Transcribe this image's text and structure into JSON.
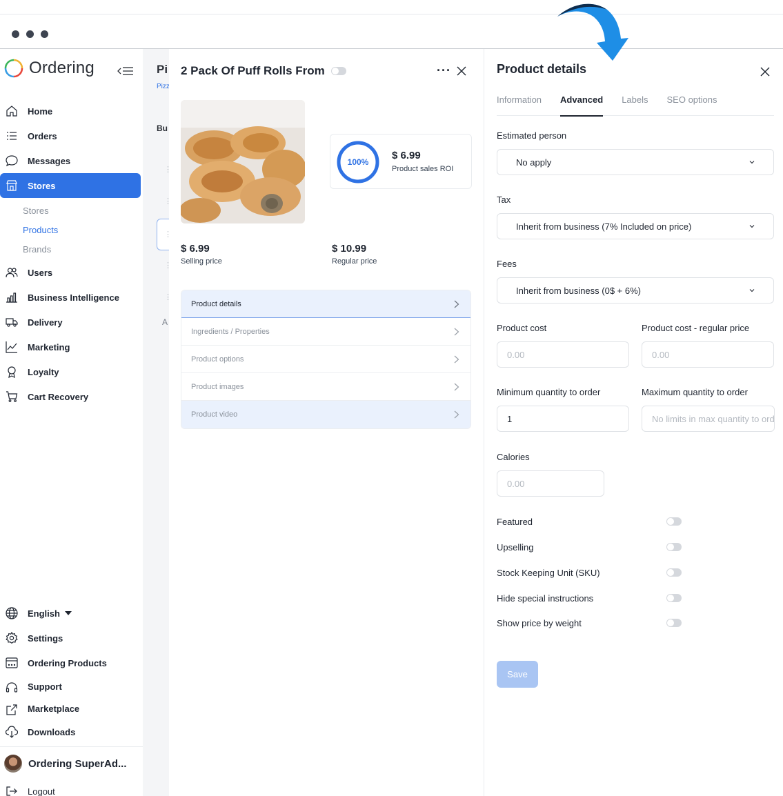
{
  "brand": {
    "name": "Ordering"
  },
  "sidebar": {
    "items": [
      {
        "label": "Home",
        "icon": "home-icon"
      },
      {
        "label": "Orders",
        "icon": "list-icon"
      },
      {
        "label": "Messages",
        "icon": "chat-icon"
      },
      {
        "label": "Stores",
        "icon": "store-icon",
        "active": true
      }
    ],
    "sub_items": [
      {
        "label": "Stores"
      },
      {
        "label": "Products",
        "active": true
      },
      {
        "label": "Brands"
      }
    ],
    "items2": [
      {
        "label": "Users",
        "icon": "users-icon"
      },
      {
        "label": "Business Intelligence",
        "icon": "bar-chart-icon"
      },
      {
        "label": "Delivery",
        "icon": "truck-icon"
      },
      {
        "label": "Marketing",
        "icon": "line-chart-icon"
      },
      {
        "label": "Loyalty",
        "icon": "award-icon"
      },
      {
        "label": "Cart Recovery",
        "icon": "cart-icon"
      }
    ],
    "bottom": [
      {
        "label": "English",
        "icon": "globe-icon"
      },
      {
        "label": "Settings",
        "icon": "gear-icon"
      },
      {
        "label": "Ordering Products",
        "icon": "window-icon"
      },
      {
        "label": "Support",
        "icon": "headset-icon"
      },
      {
        "label": "Marketplace",
        "icon": "external-link-icon"
      },
      {
        "label": "Downloads",
        "icon": "download-icon"
      }
    ],
    "user_name": "Ordering SuperAd...",
    "logout": "Logout"
  },
  "background_list": {
    "title": "Pi",
    "subtitle": "Pizz",
    "section": "Bu",
    "letter": "A"
  },
  "product": {
    "title": "2 Pack Of Puff Rolls From",
    "roi_percent": "100%",
    "roi_value": "$ 6.99",
    "roi_label": "Product sales ROI",
    "selling_price": "$ 6.99",
    "selling_price_label": "Selling price",
    "regular_price": "$ 10.99",
    "regular_price_label": "Regular price",
    "menu": [
      "Product details",
      "Ingredients / Properties",
      "Product options",
      "Product images",
      "Product video"
    ]
  },
  "details": {
    "title": "Product details",
    "tabs": [
      "Information",
      "Advanced",
      "Labels",
      "SEO options"
    ],
    "active_tab": "Advanced",
    "estimated_person": {
      "label": "Estimated person",
      "value": "No apply"
    },
    "tax": {
      "label": "Tax",
      "value": "Inherit from business (7% Included on price)"
    },
    "fees": {
      "label": "Fees",
      "value": "Inherit from business (0$ + 6%)"
    },
    "product_cost": {
      "label": "Product cost",
      "placeholder": "0.00"
    },
    "product_cost_regular": {
      "label": "Product cost - regular price",
      "placeholder": "0.00"
    },
    "min_qty": {
      "label": "Minimum quantity to order",
      "value": "1"
    },
    "max_qty": {
      "label": "Maximum quantity to order",
      "placeholder": "No limits in max quantity to order"
    },
    "calories": {
      "label": "Calories",
      "placeholder": "0.00"
    },
    "toggles": [
      "Featured",
      "Upselling",
      "Stock Keeping Unit (SKU)",
      "Hide special instructions",
      "Show price by weight"
    ],
    "save_label": "Save"
  },
  "colors": {
    "accent": "#2f72e4",
    "arrow": "#1e8ee6",
    "save_disabled": "#a9c5f3"
  }
}
